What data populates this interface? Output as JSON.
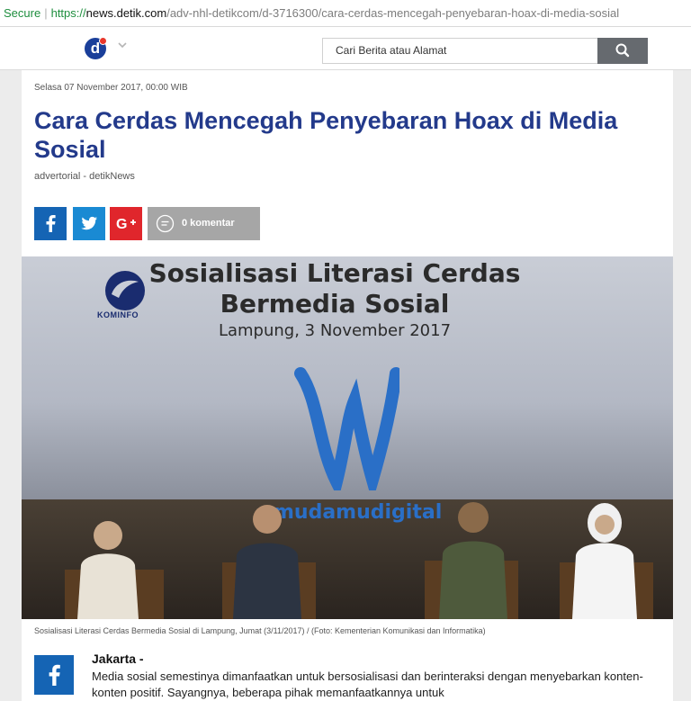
{
  "browser": {
    "secure_label": "Secure",
    "url_scheme": "https://",
    "url_host": "news.detik.com",
    "url_path": "/adv-nhl-detikcom/d-3716300/cara-cerdas-mencegah-penyebaran-hoax-di-media-sosial"
  },
  "header": {
    "logo_letter": "d",
    "logo_color": "#1a3f9a",
    "logo_dot_color": "#e8372c",
    "menu_icon": "chevron-down-icon",
    "search_placeholder": "Cari Berita atau Alamat",
    "search_icon": "search-icon"
  },
  "article": {
    "date": "Selasa 07 November 2017, 00:00 WIB",
    "title": "Cara Cerdas Mencegah Penyebaran Hoax di Media Sosial",
    "title_color": "#233a8b",
    "byline": "advertorial - detikNews",
    "share": {
      "facebook_icon": "facebook-icon",
      "twitter_icon": "twitter-icon",
      "googleplus_icon": "google-plus-icon",
      "comment_label": "0 komentar",
      "comment_icon": "comment-icon"
    },
    "photo": {
      "banner_line1": "Sosialisasi Literasi Cerdas",
      "banner_line2": "Bermedia Sosial",
      "banner_line3": "Lampung, 3 November 2017",
      "kominfo_label": "KOMINFO",
      "mudamu_label": "mudamudigital"
    },
    "caption": "Sosialisasi Literasi Cerdas Bermedia Sosial di Lampung, Jumat (3/11/2017) / (Foto: Kementerian Komunikasi dan Informatika)",
    "dateline": "Jakarta -",
    "lead": "Media sosial semestinya dimanfaatkan untuk bersosialisasi dan berinteraksi dengan menyebarkan konten-konten positif. Sayangnya, beberapa pihak memanfaatkannya untuk"
  }
}
